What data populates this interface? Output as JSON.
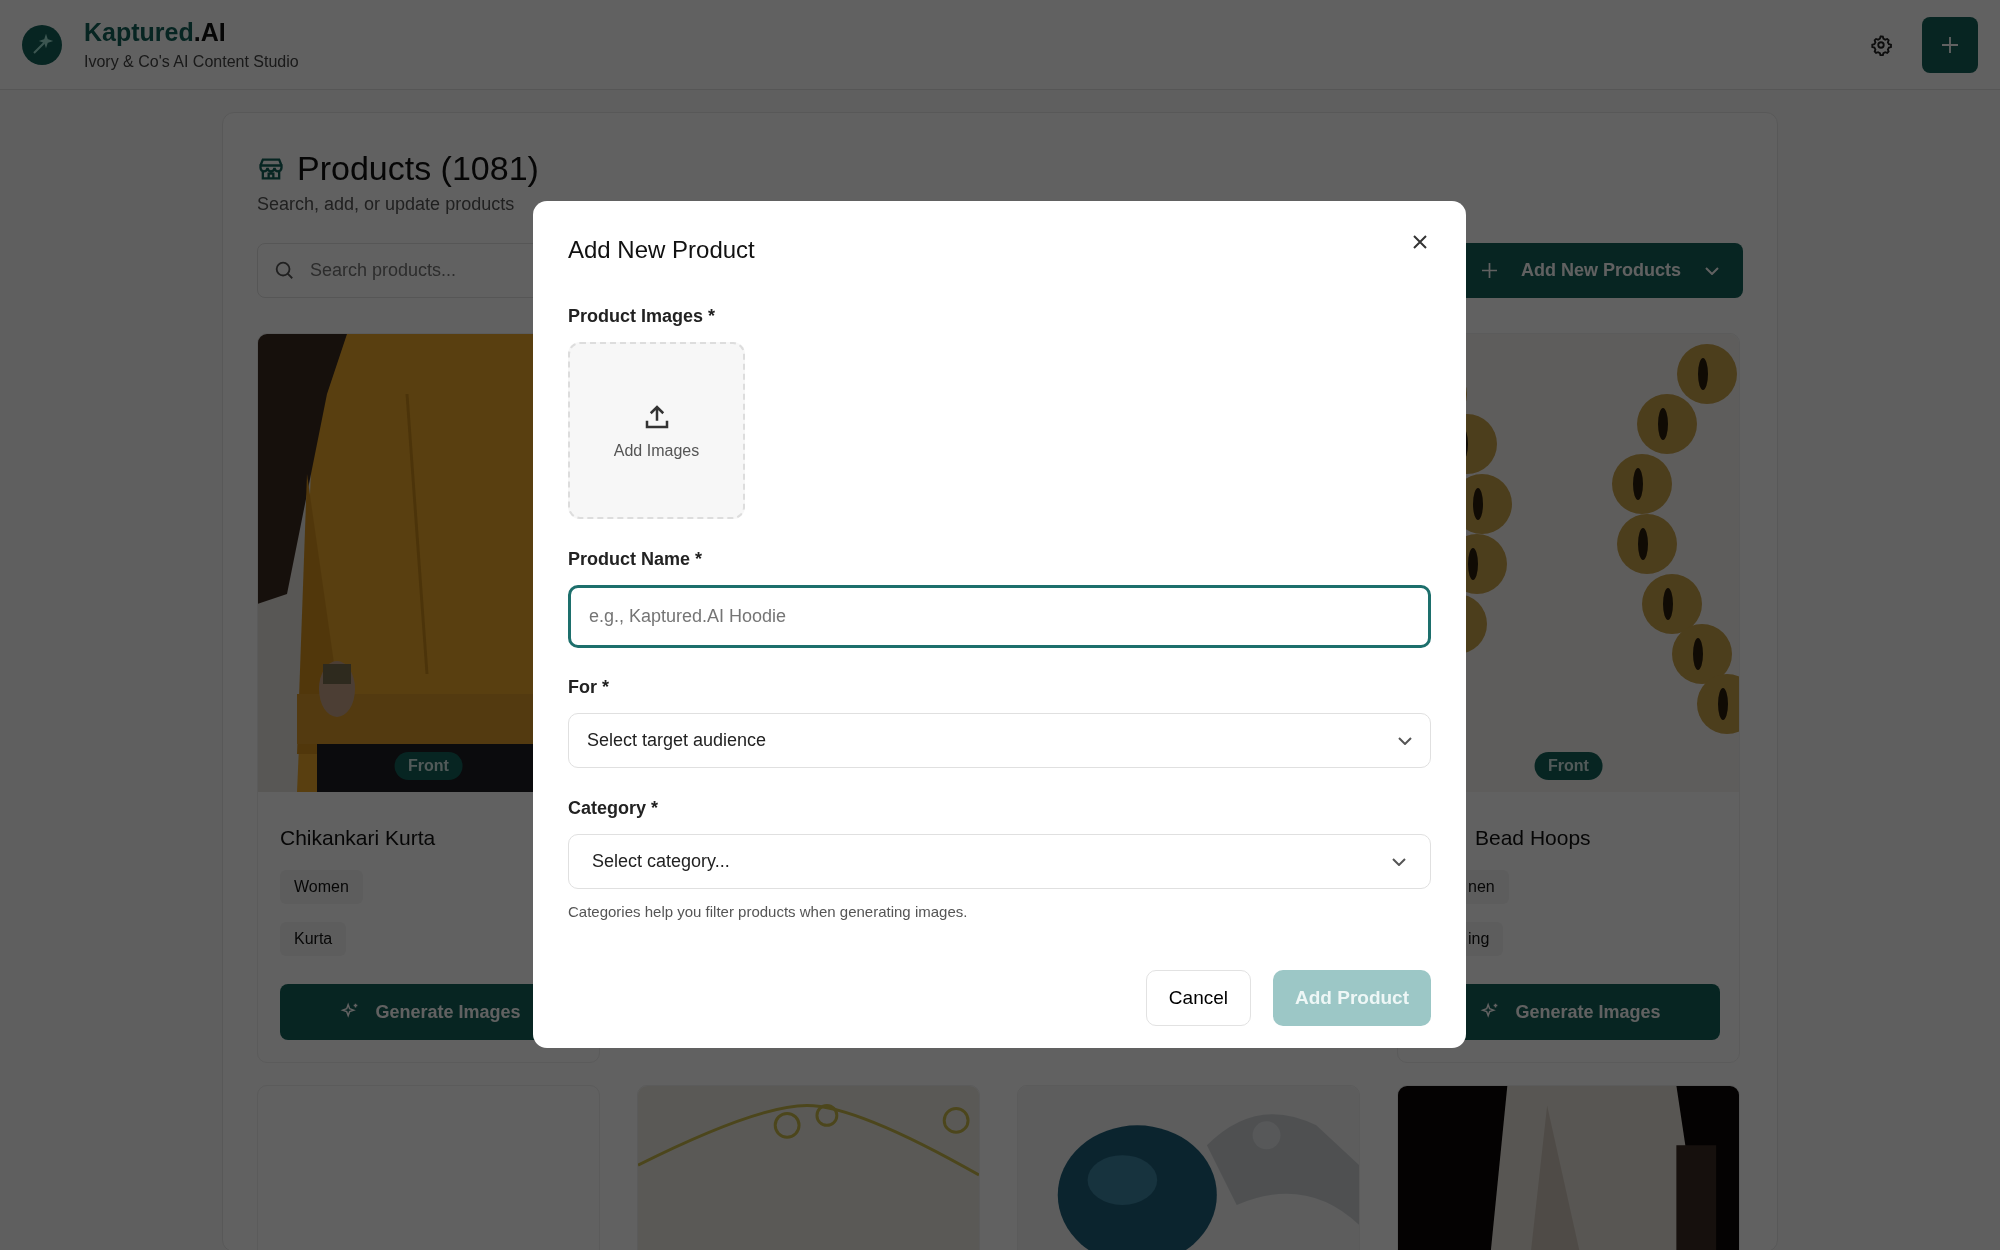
{
  "header": {
    "brand_name": "Kaptured",
    "brand_suffix": ".AI",
    "subtitle": "Ivory & Co's AI Content Studio"
  },
  "page": {
    "title": "Products (1081)",
    "subtitle": "Search, add, or update products"
  },
  "search": {
    "placeholder": "Search products..."
  },
  "add_menu_button": {
    "label": "Add New Products"
  },
  "products": [
    {
      "kind": "full",
      "badge": "Front",
      "name": "Chikankari Kurta",
      "tags": [
        "Women",
        "Kurta"
      ],
      "button": "Generate Images"
    },
    {
      "kind": "hidden"
    },
    {
      "kind": "hidden"
    },
    {
      "kind": "partial",
      "badge": "Front",
      "name": "Bead Hoops",
      "tags": [
        "nen",
        "ing"
      ],
      "button": "Generate Images"
    }
  ],
  "second_row": [
    {
      "kind": "blank"
    },
    {
      "kind": "picture"
    },
    {
      "kind": "picture"
    },
    {
      "kind": "picture"
    }
  ],
  "modal": {
    "title": "Add New Product",
    "images_label": "Product Images *",
    "upload_label": "Add Images",
    "name_label": "Product Name *",
    "name_placeholder": "e.g., Kaptured.AI Hoodie",
    "name_focused": true,
    "for_label": "For *",
    "for_value": "Select target audience",
    "category_label": "Category *",
    "category_value": "Select category...",
    "category_help": "Categories help you filter products when generating images.",
    "cancel": "Cancel",
    "submit": {
      "label": "Add Product",
      "disabled": true
    }
  }
}
